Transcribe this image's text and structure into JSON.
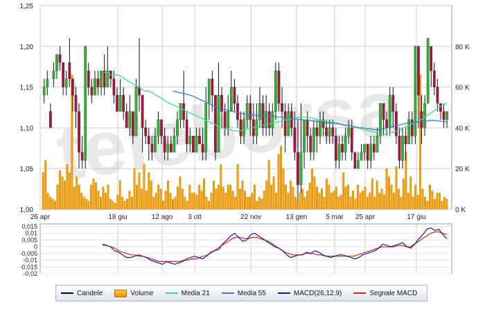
{
  "chart_data": [
    {
      "type": "candlestick",
      "y_ticks": [
        "1,25",
        "1,20",
        "1,15",
        "1,10",
        "1,05",
        "1,00"
      ],
      "ylim": [
        1.0,
        1.25
      ],
      "x_ticks": [
        "26 apr",
        "18 giu",
        "12 ago",
        "3 ott",
        "22 nov",
        "13 gen",
        "5 mar",
        "25 apr",
        "17 giu"
      ],
      "candles": [
        [
          1.14,
          1.15,
          1.16,
          1.13
        ],
        [
          1.15,
          1.16,
          1.17,
          1.14
        ],
        [
          1.12,
          1.1,
          1.13,
          1.1
        ],
        [
          1.16,
          1.17,
          1.18,
          1.15
        ],
        [
          1.17,
          1.19,
          1.19,
          1.16
        ],
        [
          1.19,
          1.18,
          1.2,
          1.17
        ],
        [
          1.18,
          1.15,
          1.18,
          1.14
        ],
        [
          1.15,
          1.16,
          1.17,
          1.14
        ],
        [
          1.18,
          1.16,
          1.21,
          1.15
        ],
        [
          1.16,
          1.14,
          1.16,
          1.12
        ],
        [
          1.14,
          1.12,
          1.15,
          1.1
        ],
        [
          1.12,
          1.07,
          1.13,
          1.05
        ],
        [
          1.07,
          1.06,
          1.09,
          1.05
        ],
        [
          1.06,
          1.2,
          1.2,
          1.05
        ],
        [
          1.17,
          1.15,
          1.18,
          1.14
        ],
        [
          1.15,
          1.14,
          1.16,
          1.13
        ],
        [
          1.14,
          1.16,
          1.17,
          1.14
        ],
        [
          1.16,
          1.15,
          1.17,
          1.14
        ],
        [
          1.15,
          1.17,
          1.17,
          1.14
        ],
        [
          1.17,
          1.15,
          1.19,
          1.14
        ],
        [
          1.15,
          1.17,
          1.2,
          1.15
        ],
        [
          1.17,
          1.16,
          1.17,
          1.15
        ],
        [
          1.16,
          1.14,
          1.17,
          1.13
        ],
        [
          1.14,
          1.12,
          1.15,
          1.12
        ],
        [
          1.12,
          1.14,
          1.16,
          1.12
        ],
        [
          1.14,
          1.12,
          1.15,
          1.11
        ],
        [
          1.12,
          1.1,
          1.13,
          1.1
        ],
        [
          1.1,
          1.12,
          1.14,
          1.09
        ],
        [
          1.12,
          1.09,
          1.12,
          1.08
        ],
        [
          1.09,
          1.15,
          1.16,
          1.09
        ],
        [
          1.15,
          1.14,
          1.21,
          1.12
        ],
        [
          1.14,
          1.1,
          1.14,
          1.07
        ],
        [
          1.1,
          1.09,
          1.11,
          1.08
        ],
        [
          1.09,
          1.08,
          1.1,
          1.06
        ],
        [
          1.08,
          1.07,
          1.09,
          1.06
        ],
        [
          1.07,
          1.09,
          1.1,
          1.07
        ],
        [
          1.09,
          1.11,
          1.12,
          1.08
        ],
        [
          1.11,
          1.09,
          1.11,
          1.08
        ],
        [
          1.09,
          1.07,
          1.1,
          1.06
        ],
        [
          1.07,
          1.08,
          1.09,
          1.06
        ],
        [
          1.08,
          1.07,
          1.09,
          1.07
        ],
        [
          1.07,
          1.09,
          1.1,
          1.07
        ],
        [
          1.09,
          1.11,
          1.12,
          1.08
        ],
        [
          1.11,
          1.13,
          1.13,
          1.1
        ],
        [
          1.13,
          1.11,
          1.17,
          1.1
        ],
        [
          1.11,
          1.08,
          1.12,
          1.07
        ],
        [
          1.08,
          1.09,
          1.1,
          1.07
        ],
        [
          1.09,
          1.07,
          1.09,
          1.07
        ],
        [
          1.07,
          1.09,
          1.1,
          1.07
        ],
        [
          1.09,
          1.08,
          1.1,
          1.08
        ],
        [
          1.08,
          1.07,
          1.1,
          1.06
        ],
        [
          1.07,
          1.13,
          1.15,
          1.06
        ],
        [
          1.13,
          1.16,
          1.16,
          1.11
        ],
        [
          1.16,
          1.14,
          1.17,
          1.12
        ],
        [
          1.14,
          1.07,
          1.14,
          1.06
        ],
        [
          1.07,
          1.14,
          1.18,
          1.07
        ],
        [
          1.14,
          1.12,
          1.15,
          1.1
        ],
        [
          1.12,
          1.1,
          1.13,
          1.09
        ],
        [
          1.1,
          1.12,
          1.14,
          1.09
        ],
        [
          1.12,
          1.15,
          1.17,
          1.12
        ],
        [
          1.15,
          1.13,
          1.16,
          1.12
        ],
        [
          1.13,
          1.11,
          1.14,
          1.1
        ],
        [
          1.11,
          1.09,
          1.12,
          1.08
        ],
        [
          1.09,
          1.11,
          1.12,
          1.08
        ],
        [
          1.11,
          1.13,
          1.14,
          1.1
        ],
        [
          1.13,
          1.11,
          1.14,
          1.09
        ],
        [
          1.11,
          1.09,
          1.13,
          1.08
        ],
        [
          1.09,
          1.11,
          1.13,
          1.08
        ],
        [
          1.11,
          1.13,
          1.15,
          1.1
        ],
        [
          1.13,
          1.1,
          1.14,
          1.09
        ],
        [
          1.1,
          1.12,
          1.14,
          1.09
        ],
        [
          1.12,
          1.1,
          1.13,
          1.09
        ],
        [
          1.1,
          1.12,
          1.13,
          1.09
        ],
        [
          1.12,
          1.17,
          1.18,
          1.11
        ],
        [
          1.17,
          1.13,
          1.18,
          1.12
        ],
        [
          1.13,
          1.12,
          1.15,
          1.1
        ],
        [
          1.12,
          1.09,
          1.13,
          1.07
        ],
        [
          1.09,
          1.12,
          1.13,
          1.09
        ],
        [
          1.12,
          1.1,
          1.13,
          1.09
        ],
        [
          1.1,
          1.07,
          1.12,
          1.06
        ],
        [
          1.07,
          1.03,
          1.11,
          1.01
        ],
        [
          1.03,
          1.07,
          1.13,
          1.02
        ],
        [
          1.07,
          1.11,
          1.11,
          1.05
        ],
        [
          1.11,
          1.09,
          1.12,
          1.07
        ],
        [
          1.09,
          1.07,
          1.1,
          1.06
        ],
        [
          1.07,
          1.1,
          1.11,
          1.06
        ],
        [
          1.1,
          1.09,
          1.11,
          1.07
        ],
        [
          1.09,
          1.11,
          1.12,
          1.08
        ],
        [
          1.11,
          1.1,
          1.12,
          1.09
        ],
        [
          1.1,
          1.09,
          1.11,
          1.08
        ],
        [
          1.09,
          1.1,
          1.11,
          1.08
        ],
        [
          1.1,
          1.09,
          1.11,
          1.08
        ],
        [
          1.09,
          1.06,
          1.1,
          1.05
        ],
        [
          1.06,
          1.08,
          1.09,
          1.05
        ],
        [
          1.08,
          1.07,
          1.09,
          1.06
        ],
        [
          1.07,
          1.09,
          1.1,
          1.06
        ],
        [
          1.09,
          1.1,
          1.11,
          1.08
        ],
        [
          1.1,
          1.07,
          1.11,
          1.06
        ],
        [
          1.07,
          1.05,
          1.07,
          1.05
        ],
        [
          1.05,
          1.06,
          1.07,
          1.05
        ],
        [
          1.06,
          1.07,
          1.08,
          1.06
        ],
        [
          1.07,
          1.08,
          1.08,
          1.06
        ],
        [
          1.08,
          1.06,
          1.08,
          1.05
        ],
        [
          1.06,
          1.08,
          1.09,
          1.05
        ],
        [
          1.08,
          1.07,
          1.09,
          1.06
        ],
        [
          1.07,
          1.09,
          1.1,
          1.07
        ],
        [
          1.09,
          1.13,
          1.13,
          1.08
        ],
        [
          1.13,
          1.11,
          1.13,
          1.09
        ],
        [
          1.11,
          1.1,
          1.12,
          1.09
        ],
        [
          1.1,
          1.14,
          1.15,
          1.09
        ],
        [
          1.14,
          1.12,
          1.15,
          1.1
        ],
        [
          1.12,
          1.09,
          1.13,
          1.08
        ],
        [
          1.09,
          1.06,
          1.1,
          1.05
        ],
        [
          1.06,
          1.09,
          1.1,
          1.05
        ],
        [
          1.09,
          1.08,
          1.1,
          1.06
        ],
        [
          1.08,
          1.11,
          1.12,
          1.08
        ],
        [
          1.11,
          1.09,
          1.12,
          1.08
        ],
        [
          1.09,
          1.2,
          1.2,
          1.08
        ],
        [
          1.2,
          1.14,
          1.2,
          1.1
        ],
        [
          1.12,
          1.1,
          1.14,
          1.08
        ],
        [
          1.1,
          1.13,
          1.14,
          1.09
        ],
        [
          1.13,
          1.21,
          1.21,
          1.13
        ],
        [
          1.2,
          1.17,
          1.2,
          1.15
        ],
        [
          1.17,
          1.15,
          1.18,
          1.14
        ],
        [
          1.15,
          1.13,
          1.16,
          1.12
        ],
        [
          1.13,
          1.12,
          1.13,
          1.11
        ],
        [
          1.12,
          1.11,
          1.13,
          1.1
        ],
        [
          1.11,
          1.12,
          1.12,
          1.1
        ]
      ],
      "media_21": [
        1.168,
        1.168,
        1.165,
        1.165,
        1.165,
        1.163,
        1.16,
        1.157,
        1.155,
        1.152,
        1.15,
        1.147,
        1.145,
        1.145,
        1.143,
        1.14,
        1.138,
        1.135,
        1.132,
        1.13,
        1.128,
        1.126,
        1.124,
        1.122,
        1.12,
        1.118,
        1.116,
        1.114,
        1.112,
        1.11,
        1.108,
        1.106,
        1.104,
        1.102,
        1.1,
        1.099,
        1.098,
        1.097,
        1.096,
        1.096,
        1.097,
        1.098,
        1.099,
        1.1,
        1.101,
        1.102,
        1.103,
        1.104,
        1.105,
        1.106,
        1.107,
        1.108,
        1.109,
        1.11,
        1.111,
        1.112,
        1.113,
        1.113,
        1.113,
        1.113,
        1.112,
        1.111,
        1.11,
        1.109,
        1.108,
        1.107,
        1.107,
        1.106,
        1.105,
        1.104,
        1.103,
        1.102,
        1.101,
        1.1,
        1.099,
        1.098,
        1.097,
        1.096,
        1.095,
        1.094,
        1.093,
        1.092,
        1.093,
        1.094,
        1.095,
        1.097,
        1.099,
        1.101,
        1.103,
        1.105,
        1.107,
        1.109,
        1.111,
        1.114,
        1.117,
        1.12,
        1.123,
        1.126,
        1.128,
        1.13
      ],
      "media_55": [
        1.145,
        1.144,
        1.143,
        1.142,
        1.141,
        1.14,
        1.138,
        1.136,
        1.134,
        1.132,
        1.13,
        1.128,
        1.126,
        1.124,
        1.123,
        1.122,
        1.121,
        1.12,
        1.119,
        1.118,
        1.117,
        1.117,
        1.116,
        1.116,
        1.115,
        1.115,
        1.115,
        1.114,
        1.114,
        1.114,
        1.113,
        1.113,
        1.112,
        1.112,
        1.111,
        1.111,
        1.11,
        1.11,
        1.109,
        1.109,
        1.108,
        1.108,
        1.107,
        1.107,
        1.106,
        1.106,
        1.105,
        1.105,
        1.104,
        1.103,
        1.103,
        1.102,
        1.101,
        1.1,
        1.1,
        1.099,
        1.099,
        1.098,
        1.098,
        1.098,
        1.099,
        1.1,
        1.101,
        1.102,
        1.103,
        1.104,
        1.105,
        1.106,
        1.106,
        1.107,
        1.107,
        1.108,
        1.108,
        1.109,
        1.109,
        1.109,
        1.108,
        1.108,
        1.107
      ]
    },
    {
      "type": "bar",
      "y_ticks": [
        "80 K",
        "60 K",
        "40 K",
        "20 K",
        "0 K"
      ],
      "ylim": [
        0,
        100
      ],
      "values": [
        18,
        24,
        8,
        6,
        5,
        4,
        12,
        19,
        16,
        14,
        22,
        18,
        66,
        11,
        16,
        12,
        8,
        6,
        5,
        4,
        12,
        15,
        13,
        9,
        6,
        11,
        8,
        12,
        5,
        4,
        3,
        7,
        14,
        6,
        4,
        5,
        9,
        6,
        20,
        12,
        18,
        10,
        22,
        9,
        18,
        14,
        6,
        8,
        12,
        10,
        4,
        9,
        14,
        8,
        5,
        6,
        11,
        16,
        10,
        6,
        4,
        12,
        8,
        8,
        7,
        12,
        9,
        15,
        6,
        4,
        8,
        14,
        10,
        12,
        22,
        11,
        8,
        12,
        12,
        9,
        6,
        22,
        10,
        14,
        9,
        6,
        6,
        8,
        12,
        4,
        6,
        5,
        9,
        14,
        24,
        12,
        16,
        8,
        27,
        31,
        20,
        12,
        8,
        14,
        11,
        6,
        4,
        8,
        10,
        6,
        9,
        13,
        20,
        16,
        11,
        8,
        10,
        6,
        15,
        12,
        8,
        9,
        11,
        6,
        7,
        18,
        11,
        12,
        6,
        9,
        5,
        12,
        8,
        9,
        11,
        6,
        8,
        15,
        6,
        14,
        8,
        10,
        7,
        20,
        16,
        12,
        8,
        21,
        10,
        6,
        15,
        28,
        8,
        16,
        6,
        12,
        7,
        66,
        10,
        6,
        4,
        12,
        9,
        5,
        8,
        8,
        4,
        6,
        5
      ],
      "volume_scale_note": ""
    },
    {
      "type": "line",
      "y_ticks": [
        "0,015",
        "0,01",
        "0,005",
        "0",
        "-0,005",
        "-0,01",
        "-0,015",
        "-0,02"
      ],
      "ylim": [
        -0.02,
        0.017
      ],
      "macd": [
        0.002,
        0.001,
        0.0,
        -0.003,
        -0.004,
        -0.006,
        -0.008,
        -0.008,
        -0.007,
        -0.006,
        -0.007,
        -0.008,
        -0.01,
        -0.011,
        -0.012,
        -0.013,
        -0.011,
        -0.012,
        -0.013,
        -0.012,
        -0.011,
        -0.009,
        -0.008,
        -0.007,
        -0.008,
        -0.009,
        -0.007,
        -0.004,
        -0.003,
        -0.002,
        0.002,
        0.005,
        0.008,
        0.01,
        0.007,
        0.004,
        0.005,
        0.009,
        0.01,
        0.008,
        0.006,
        0.004,
        0.002,
        0.0,
        -0.001,
        -0.003,
        -0.006,
        -0.008,
        -0.007,
        -0.006,
        -0.006,
        -0.004,
        -0.005,
        -0.003,
        -0.004,
        -0.006,
        -0.007,
        -0.008,
        -0.007,
        -0.006,
        -0.006,
        -0.007,
        -0.008,
        -0.009,
        -0.008,
        -0.006,
        -0.005,
        -0.004,
        -0.003,
        -0.001,
        0.002,
        0.001,
        0.0,
        0.001,
        0.002,
        0.003,
        0.0,
        -0.001,
        0.002,
        0.006,
        0.009,
        0.013,
        0.014,
        0.012,
        0.013,
        0.009,
        0.006
      ],
      "segnale_macd": [
        0.001,
        0.001,
        0.0,
        -0.001,
        -0.003,
        -0.004,
        -0.005,
        -0.006,
        -0.006,
        -0.007,
        -0.007,
        -0.008,
        -0.009,
        -0.01,
        -0.011,
        -0.011,
        -0.011,
        -0.011,
        -0.011,
        -0.011,
        -0.01,
        -0.01,
        -0.009,
        -0.009,
        -0.008,
        -0.007,
        -0.006,
        -0.004,
        -0.002,
        0.0,
        0.002,
        0.004,
        0.006,
        0.007,
        0.007,
        0.006,
        0.006,
        0.007,
        0.007,
        0.006,
        0.005,
        0.004,
        0.002,
        0.0,
        -0.002,
        -0.004,
        -0.005,
        -0.006,
        -0.006,
        -0.006,
        -0.005,
        -0.005,
        -0.005,
        -0.006,
        -0.006,
        -0.007,
        -0.007,
        -0.007,
        -0.007,
        -0.007,
        -0.007,
        -0.007,
        -0.007,
        -0.006,
        -0.005,
        -0.004,
        -0.003,
        -0.002,
        -0.001,
        0.0,
        0.0,
        0.0,
        0.0,
        0.001,
        0.001,
        0.0,
        0.0,
        0.002,
        0.004,
        0.006,
        0.008,
        0.01,
        0.011,
        0.011,
        0.01,
        0.009
      ]
    }
  ],
  "legend": [
    {
      "label": "Candele",
      "kind": "line",
      "color": "#000000"
    },
    {
      "label": "Volume",
      "kind": "box",
      "color": "#f5a000"
    },
    {
      "label": "Media 21",
      "kind": "line",
      "color": "#39e08a"
    },
    {
      "label": "Media 55",
      "kind": "line",
      "color": "#3a7fd5"
    },
    {
      "label": "MACD(26,12,9)",
      "kind": "line",
      "color": "#1a1aa8"
    },
    {
      "label": "Segnale MACD",
      "kind": "line",
      "color": "#e02020"
    }
  ],
  "colors": {
    "up": "#2db52d",
    "down": "#a8123c",
    "volume": "#f5a000",
    "grid": "#cfcfcf",
    "watermark": "#e8e8e8"
  }
}
